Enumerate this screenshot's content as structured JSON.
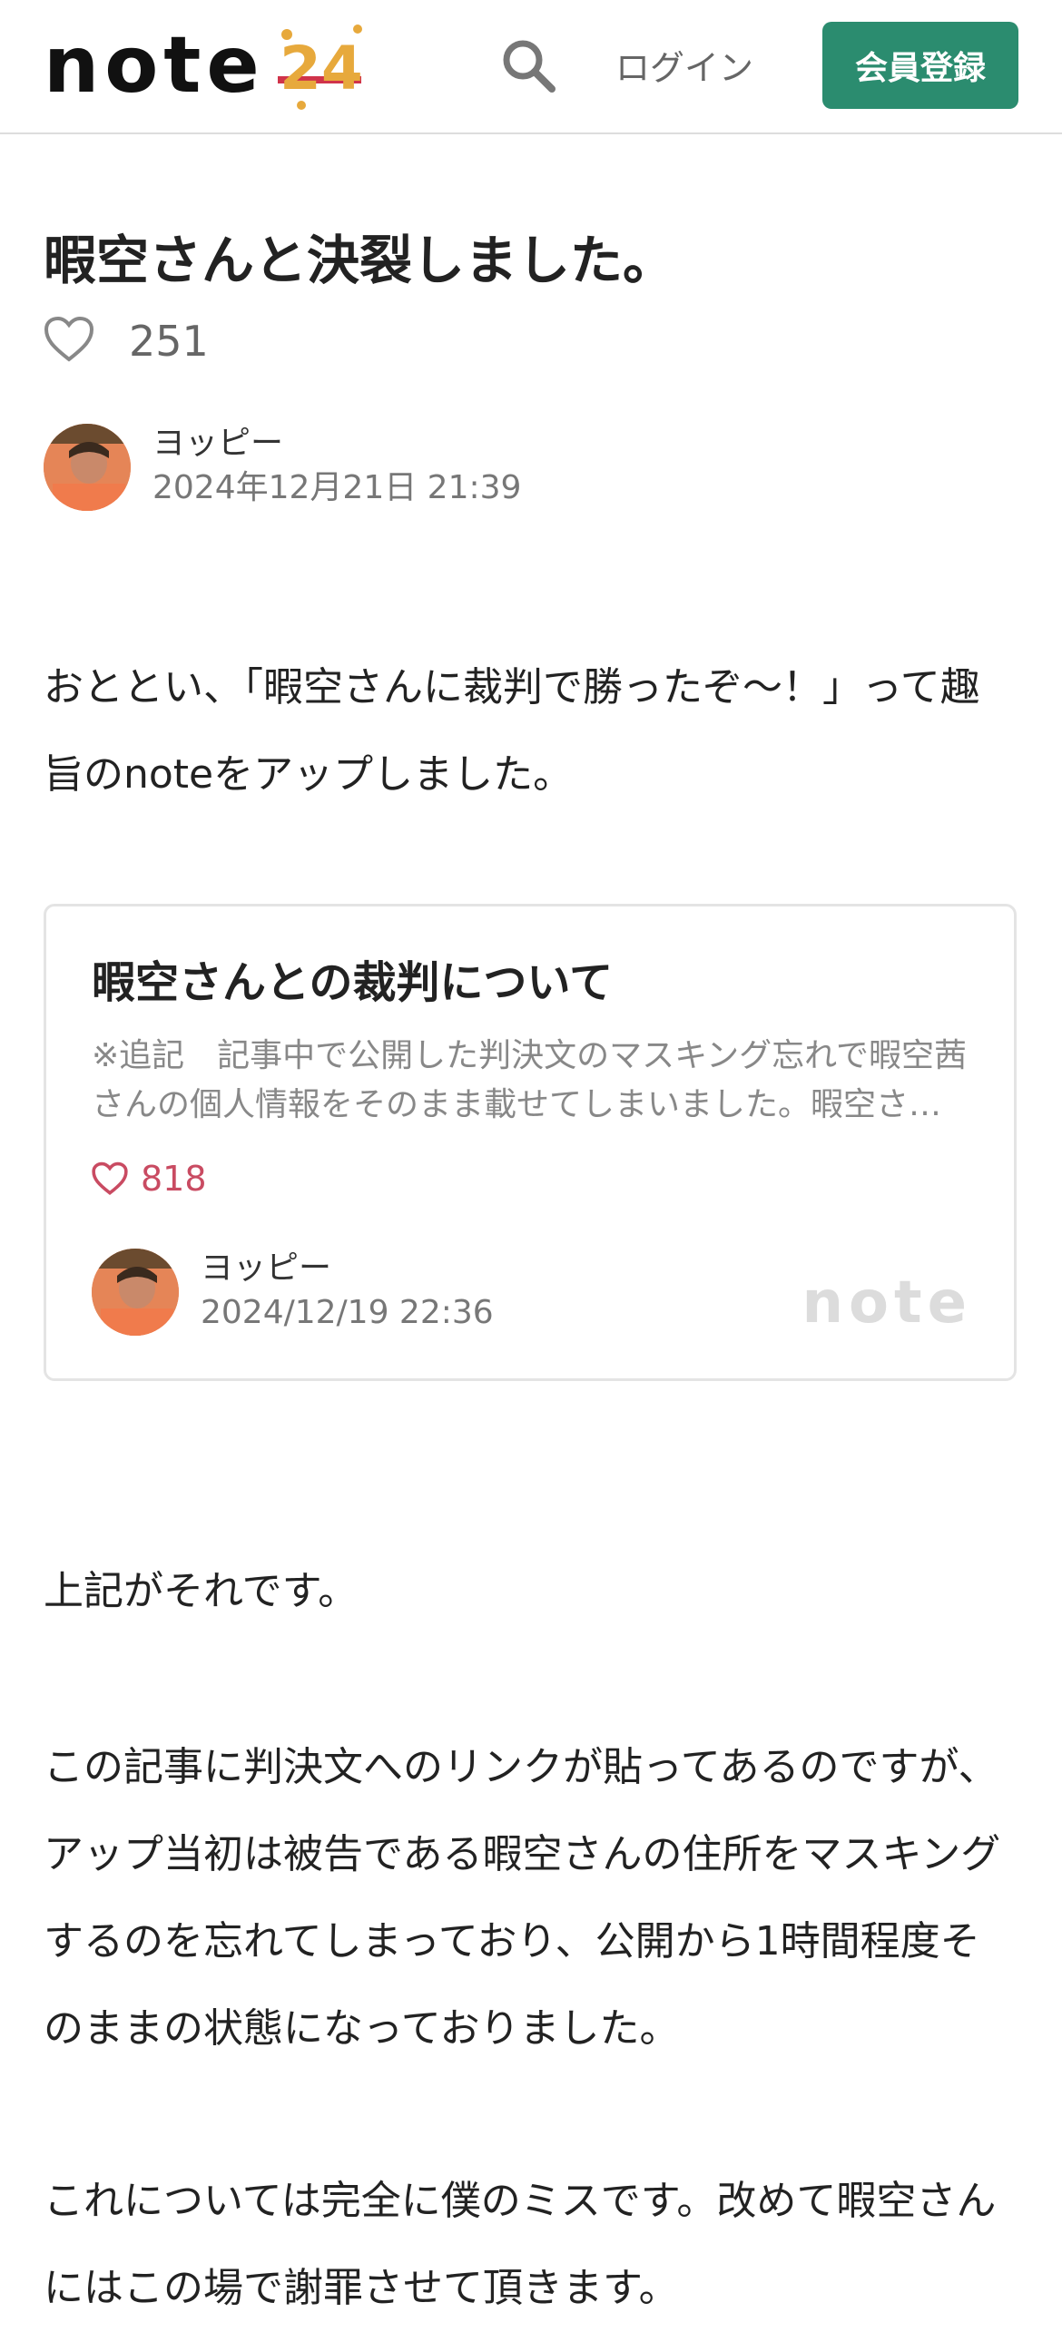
{
  "header": {
    "logo_text": "note",
    "badge_text": "24",
    "login_label": "ログイン",
    "signup_label": "会員登録"
  },
  "article": {
    "title": "暇空さんと決裂しました。",
    "like_count": "251",
    "author_name": "ヨッピー",
    "date": "2024年12月21日 21:39",
    "paragraphs": [
      "おととい、「暇空さんに裁判で勝ったぞ〜！」って趣旨のnoteをアップしました。",
      "上記がそれです。",
      "この記事に判決文へのリンクが貼ってあるのですが、アップ当初は被告である暇空さんの住所をマスキングするのを忘れてしまっており、公開から1時間程度そのままの状態になっておりました。",
      "これについては完全に僕のミスです。改めて暇空さんにはこの場で謝罪させて頂きます。"
    ]
  },
  "embed_card": {
    "title": "暇空さんとの裁判について",
    "excerpt": "※追記　記事中で公開した判決文のマスキング忘れで暇空茜さんの個人情報をそのまま載せてしまいました。暇空さ…",
    "like_count": "818",
    "author_name": "ヨッピー",
    "date": "2024/12/19 22:36",
    "watermark": "note"
  },
  "colors": {
    "brand_green": "#2b8c6f",
    "like_red": "#c94b62"
  },
  "icons": [
    "search-icon",
    "heart-icon",
    "heart-outline-icon"
  ]
}
